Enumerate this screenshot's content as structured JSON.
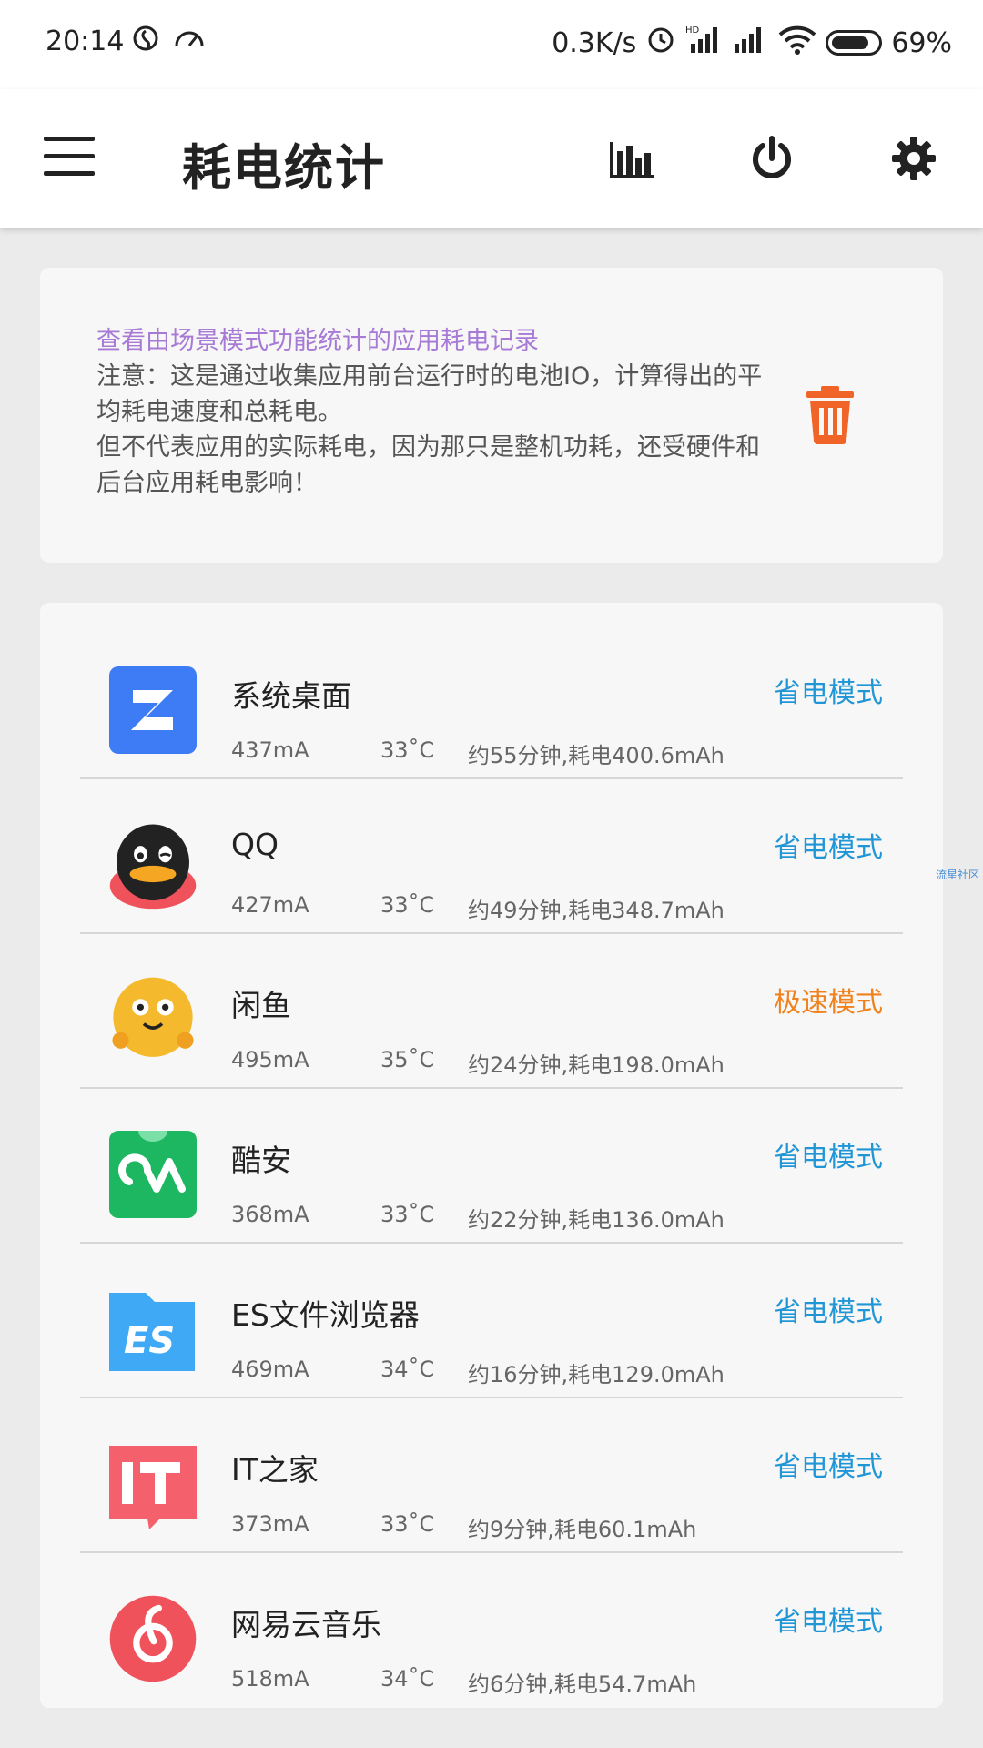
{
  "status_bar": {
    "time": "20:14",
    "net_speed": "0.3K/s",
    "battery_percent": "69%",
    "battery_level": 0.69,
    "icons": [
      "netease-icon",
      "speedometer-icon",
      "alarm-icon",
      "hd-signal-icon",
      "signal-icon",
      "wifi-icon",
      "battery-icon"
    ]
  },
  "toolbar": {
    "title": "耗电统计",
    "icons": [
      "menu-icon",
      "bar-chart-icon",
      "power-icon",
      "settings-icon"
    ]
  },
  "info": {
    "title": "查看由场景模式功能统计的应用耗电记录",
    "line1": "注意：这是通过收集应用前台运行时的电池IO，计算得出的平均耗电速度和总耗电。",
    "line2": "但不代表应用的实际耗电，因为那只是整机功耗，还受硬件和后台应用耗电影响！",
    "accent_color": "#a77ad6",
    "trash_color": "#f06428"
  },
  "apps": [
    {
      "name": "系统桌面",
      "current": "437mA",
      "temp": "33˚C",
      "summary": "约55分钟,耗电400.6mAh",
      "mode": "省电模式",
      "mode_color": "#2196d6",
      "icon": "launcher-icon"
    },
    {
      "name": "QQ",
      "current": "427mA",
      "temp": "33˚C",
      "summary": "约49分钟,耗电348.7mAh",
      "mode": "省电模式",
      "mode_color": "#2196d6",
      "icon": "qq-icon"
    },
    {
      "name": "闲鱼",
      "current": "495mA",
      "temp": "35˚C",
      "summary": "约24分钟,耗电198.0mAh",
      "mode": "极速模式",
      "mode_color": "#f0821e",
      "icon": "xianyu-icon"
    },
    {
      "name": "酷安",
      "current": "368mA",
      "temp": "33˚C",
      "summary": "约22分钟,耗电136.0mAh",
      "mode": "省电模式",
      "mode_color": "#2196d6",
      "icon": "coolapk-icon"
    },
    {
      "name": "ES文件浏览器",
      "current": "469mA",
      "temp": "34˚C",
      "summary": "约16分钟,耗电129.0mAh",
      "mode": "省电模式",
      "mode_color": "#2196d6",
      "icon": "es-file-explorer-icon"
    },
    {
      "name": "IT之家",
      "current": "373mA",
      "temp": "33˚C",
      "summary": "约9分钟,耗电60.1mAh",
      "mode": "省电模式",
      "mode_color": "#2196d6",
      "icon": "ithome-icon"
    },
    {
      "name": "网易云音乐",
      "current": "518mA",
      "temp": "34˚C",
      "summary": "约6分钟,耗电54.7mAh",
      "mode": "省电模式",
      "mode_color": "#2196d6",
      "icon": "netease-music-icon"
    }
  ],
  "watermark": "流星社区"
}
